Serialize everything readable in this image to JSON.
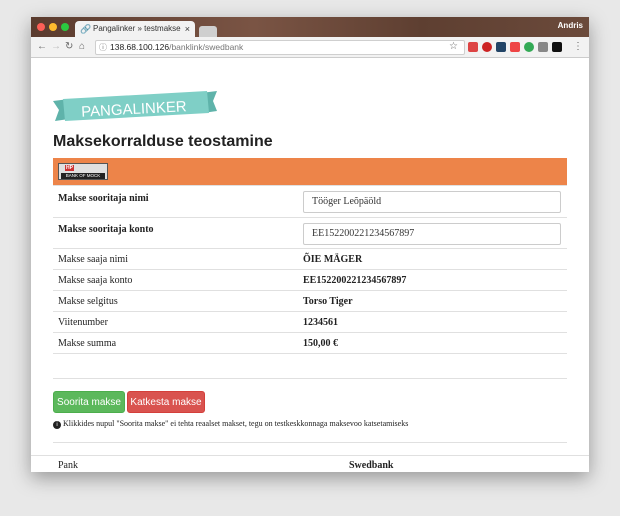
{
  "browser": {
    "tab_title": "Pangalinker » testmakse",
    "user": "Andris",
    "url_host": "138.68.100.126",
    "url_path": "/banklink/swedbank"
  },
  "page": {
    "logo_text": "PANGALINKER",
    "title": "Maksekorralduse teostamine",
    "bank_logo_top": "HP",
    "bank_logo_bottom": "BANK OF MOCK",
    "payer_name_label": "Makse sooritaja nimi",
    "payer_name_value": "Tööger Leõpäöld",
    "payer_account_label": "Makse sooritaja konto",
    "payer_account_value": "EE152200221234567897",
    "details": [
      {
        "label": "Makse saaja nimi",
        "value": "ÕIE MÄGER"
      },
      {
        "label": "Makse saaja konto",
        "value": "EE152200221234567897"
      },
      {
        "label": "Makse selgitus",
        "value": "Torso Tiger"
      },
      {
        "label": "Viitenumber",
        "value": "1234561"
      },
      {
        "label": "Makse summa",
        "value": "150,00 €"
      }
    ],
    "submit_label": "Soorita makse",
    "cancel_label": "Katkesta makse",
    "note_text": "Klikkides nupul \"Soorita makse\" ei tehta reaalset makset, tegu on testkeskkonnaga maksevoo katsetamiseks",
    "footer_label": "Pank",
    "footer_value": "Swedbank"
  },
  "colors": {
    "bank_bar": "#ed8449",
    "logo_ribbon": "#7fcfc6",
    "submit": "#5cb85c",
    "cancel": "#d9534f"
  }
}
